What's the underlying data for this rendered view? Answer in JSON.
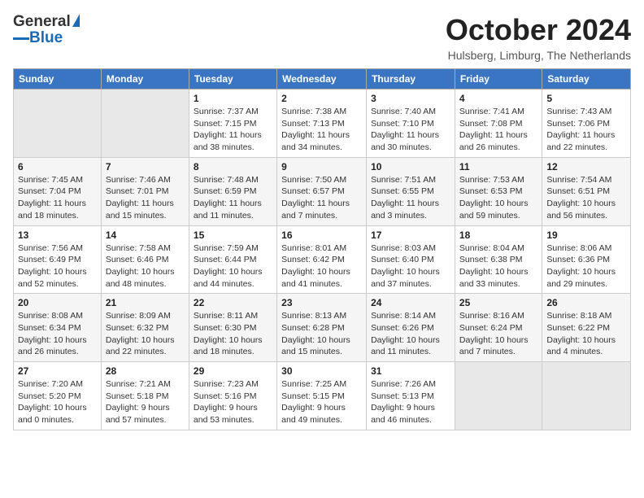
{
  "logo": {
    "text_general": "General",
    "text_blue": "Blue"
  },
  "header": {
    "month": "October 2024",
    "location": "Hulsberg, Limburg, The Netherlands"
  },
  "weekdays": [
    "Sunday",
    "Monday",
    "Tuesday",
    "Wednesday",
    "Thursday",
    "Friday",
    "Saturday"
  ],
  "weeks": [
    [
      {
        "day": "",
        "empty": true
      },
      {
        "day": "",
        "empty": true
      },
      {
        "day": "1",
        "sunrise": "Sunrise: 7:37 AM",
        "sunset": "Sunset: 7:15 PM",
        "daylight": "Daylight: 11 hours and 38 minutes."
      },
      {
        "day": "2",
        "sunrise": "Sunrise: 7:38 AM",
        "sunset": "Sunset: 7:13 PM",
        "daylight": "Daylight: 11 hours and 34 minutes."
      },
      {
        "day": "3",
        "sunrise": "Sunrise: 7:40 AM",
        "sunset": "Sunset: 7:10 PM",
        "daylight": "Daylight: 11 hours and 30 minutes."
      },
      {
        "day": "4",
        "sunrise": "Sunrise: 7:41 AM",
        "sunset": "Sunset: 7:08 PM",
        "daylight": "Daylight: 11 hours and 26 minutes."
      },
      {
        "day": "5",
        "sunrise": "Sunrise: 7:43 AM",
        "sunset": "Sunset: 7:06 PM",
        "daylight": "Daylight: 11 hours and 22 minutes."
      }
    ],
    [
      {
        "day": "6",
        "sunrise": "Sunrise: 7:45 AM",
        "sunset": "Sunset: 7:04 PM",
        "daylight": "Daylight: 11 hours and 18 minutes."
      },
      {
        "day": "7",
        "sunrise": "Sunrise: 7:46 AM",
        "sunset": "Sunset: 7:01 PM",
        "daylight": "Daylight: 11 hours and 15 minutes."
      },
      {
        "day": "8",
        "sunrise": "Sunrise: 7:48 AM",
        "sunset": "Sunset: 6:59 PM",
        "daylight": "Daylight: 11 hours and 11 minutes."
      },
      {
        "day": "9",
        "sunrise": "Sunrise: 7:50 AM",
        "sunset": "Sunset: 6:57 PM",
        "daylight": "Daylight: 11 hours and 7 minutes."
      },
      {
        "day": "10",
        "sunrise": "Sunrise: 7:51 AM",
        "sunset": "Sunset: 6:55 PM",
        "daylight": "Daylight: 11 hours and 3 minutes."
      },
      {
        "day": "11",
        "sunrise": "Sunrise: 7:53 AM",
        "sunset": "Sunset: 6:53 PM",
        "daylight": "Daylight: 10 hours and 59 minutes."
      },
      {
        "day": "12",
        "sunrise": "Sunrise: 7:54 AM",
        "sunset": "Sunset: 6:51 PM",
        "daylight": "Daylight: 10 hours and 56 minutes."
      }
    ],
    [
      {
        "day": "13",
        "sunrise": "Sunrise: 7:56 AM",
        "sunset": "Sunset: 6:49 PM",
        "daylight": "Daylight: 10 hours and 52 minutes."
      },
      {
        "day": "14",
        "sunrise": "Sunrise: 7:58 AM",
        "sunset": "Sunset: 6:46 PM",
        "daylight": "Daylight: 10 hours and 48 minutes."
      },
      {
        "day": "15",
        "sunrise": "Sunrise: 7:59 AM",
        "sunset": "Sunset: 6:44 PM",
        "daylight": "Daylight: 10 hours and 44 minutes."
      },
      {
        "day": "16",
        "sunrise": "Sunrise: 8:01 AM",
        "sunset": "Sunset: 6:42 PM",
        "daylight": "Daylight: 10 hours and 41 minutes."
      },
      {
        "day": "17",
        "sunrise": "Sunrise: 8:03 AM",
        "sunset": "Sunset: 6:40 PM",
        "daylight": "Daylight: 10 hours and 37 minutes."
      },
      {
        "day": "18",
        "sunrise": "Sunrise: 8:04 AM",
        "sunset": "Sunset: 6:38 PM",
        "daylight": "Daylight: 10 hours and 33 minutes."
      },
      {
        "day": "19",
        "sunrise": "Sunrise: 8:06 AM",
        "sunset": "Sunset: 6:36 PM",
        "daylight": "Daylight: 10 hours and 29 minutes."
      }
    ],
    [
      {
        "day": "20",
        "sunrise": "Sunrise: 8:08 AM",
        "sunset": "Sunset: 6:34 PM",
        "daylight": "Daylight: 10 hours and 26 minutes."
      },
      {
        "day": "21",
        "sunrise": "Sunrise: 8:09 AM",
        "sunset": "Sunset: 6:32 PM",
        "daylight": "Daylight: 10 hours and 22 minutes."
      },
      {
        "day": "22",
        "sunrise": "Sunrise: 8:11 AM",
        "sunset": "Sunset: 6:30 PM",
        "daylight": "Daylight: 10 hours and 18 minutes."
      },
      {
        "day": "23",
        "sunrise": "Sunrise: 8:13 AM",
        "sunset": "Sunset: 6:28 PM",
        "daylight": "Daylight: 10 hours and 15 minutes."
      },
      {
        "day": "24",
        "sunrise": "Sunrise: 8:14 AM",
        "sunset": "Sunset: 6:26 PM",
        "daylight": "Daylight: 10 hours and 11 minutes."
      },
      {
        "day": "25",
        "sunrise": "Sunrise: 8:16 AM",
        "sunset": "Sunset: 6:24 PM",
        "daylight": "Daylight: 10 hours and 7 minutes."
      },
      {
        "day": "26",
        "sunrise": "Sunrise: 8:18 AM",
        "sunset": "Sunset: 6:22 PM",
        "daylight": "Daylight: 10 hours and 4 minutes."
      }
    ],
    [
      {
        "day": "27",
        "sunrise": "Sunrise: 7:20 AM",
        "sunset": "Sunset: 5:20 PM",
        "daylight": "Daylight: 10 hours and 0 minutes."
      },
      {
        "day": "28",
        "sunrise": "Sunrise: 7:21 AM",
        "sunset": "Sunset: 5:18 PM",
        "daylight": "Daylight: 9 hours and 57 minutes."
      },
      {
        "day": "29",
        "sunrise": "Sunrise: 7:23 AM",
        "sunset": "Sunset: 5:16 PM",
        "daylight": "Daylight: 9 hours and 53 minutes."
      },
      {
        "day": "30",
        "sunrise": "Sunrise: 7:25 AM",
        "sunset": "Sunset: 5:15 PM",
        "daylight": "Daylight: 9 hours and 49 minutes."
      },
      {
        "day": "31",
        "sunrise": "Sunrise: 7:26 AM",
        "sunset": "Sunset: 5:13 PM",
        "daylight": "Daylight: 9 hours and 46 minutes."
      },
      {
        "day": "",
        "empty": true
      },
      {
        "day": "",
        "empty": true
      }
    ]
  ]
}
